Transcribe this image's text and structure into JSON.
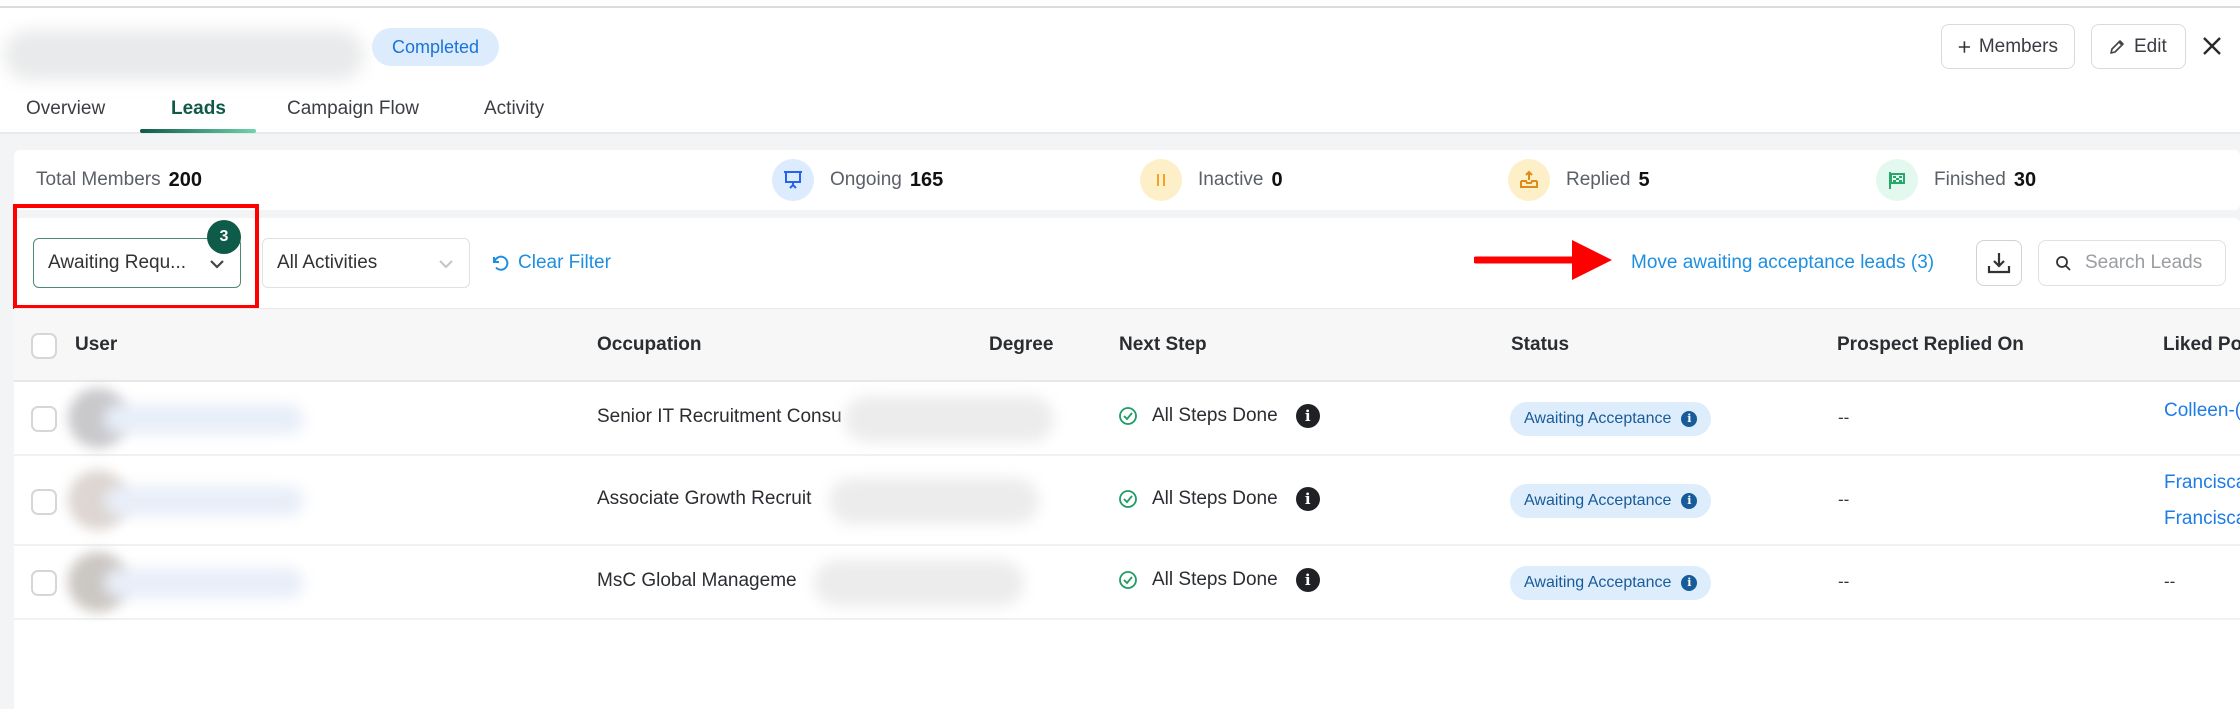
{
  "header": {
    "campaign_status": "Completed",
    "members_button": "Members",
    "edit_button": "Edit"
  },
  "tabs": [
    {
      "label": "Overview",
      "active": false
    },
    {
      "label": "Leads",
      "active": true
    },
    {
      "label": "Campaign Flow",
      "active": false
    },
    {
      "label": "Activity",
      "active": false
    }
  ],
  "stats": {
    "total": {
      "label": "Total Members",
      "value": "200"
    },
    "ongoing": {
      "label": "Ongoing",
      "value": "165",
      "icon": "presentation-icon",
      "color": "#2563eb",
      "bg": "#dcebfd"
    },
    "inactive": {
      "label": "Inactive",
      "value": "0",
      "icon": "pause-icon",
      "color": "#f0a326",
      "bg": "#fdefc8"
    },
    "replied": {
      "label": "Replied",
      "value": "5",
      "icon": "inbox-upload-icon",
      "color": "#e08a1a",
      "bg": "#fdefc8"
    },
    "finished": {
      "label": "Finished",
      "value": "30",
      "icon": "checkered-flag-icon",
      "color": "#27a86b",
      "bg": "#e3f8ee"
    }
  },
  "filters": {
    "status_select": "Awaiting Requ...",
    "status_badge": "3",
    "activities_select": "All Activities",
    "clear_filter": "Clear Filter",
    "move_link": "Move awaiting acceptance leads (3)",
    "search_placeholder": "Search Leads"
  },
  "table": {
    "columns": [
      "User",
      "Occupation",
      "Degree",
      "Next Step",
      "Status",
      "Prospect Replied On",
      "Liked Po"
    ],
    "rows": [
      {
        "occupation": "Senior IT Recruitment Consu",
        "next_step": "All Steps Done",
        "status": "Awaiting Acceptance",
        "replied_on": "--",
        "liked_posts": [
          "Colleen-("
        ]
      },
      {
        "occupation": "Associate Growth Recruit",
        "next_step": "All Steps Done",
        "status": "Awaiting Acceptance",
        "replied_on": "--",
        "liked_posts": [
          "Francisca",
          "Francisca"
        ]
      },
      {
        "occupation": "MsC Global Manageme",
        "next_step": "All Steps Done",
        "status": "Awaiting Acceptance",
        "replied_on": "--",
        "liked_posts": [
          "--"
        ]
      }
    ]
  },
  "colors": {
    "brand": "#0e5b49",
    "link": "#1e8fe0",
    "annotation": "#ff0000"
  }
}
